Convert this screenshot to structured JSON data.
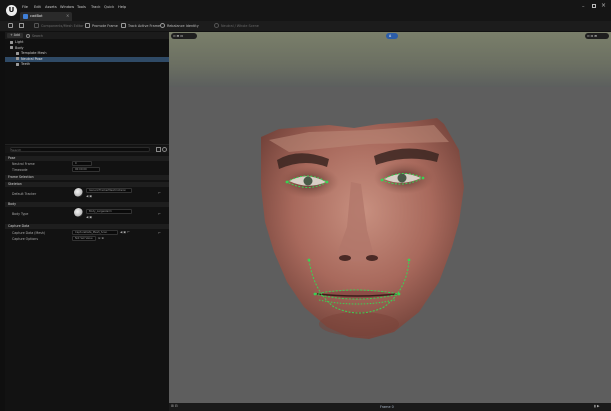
{
  "app": {
    "tab_title": "cadBot"
  },
  "menu": [
    "File",
    "Edit",
    "Assets",
    "Window",
    "Tools",
    "Track",
    "Quick",
    "Help"
  ],
  "toolbar": {
    "dropdown_label": "Components/Mesh Editor",
    "promote_frame": "Promote Frame",
    "track_active_frame": "Track Active Frame",
    "rebalance_identity": "Rebalance Identity",
    "neutral_label": "Neutral / Whole Scene"
  },
  "outliner": {
    "add_label": "+ Add",
    "search_placeholder": "Search",
    "items": [
      {
        "label": "Light",
        "indent": 0,
        "selected": false
      },
      {
        "label": "Body",
        "indent": 0,
        "selected": false
      },
      {
        "label": "Template Mesh",
        "indent": 1,
        "selected": false
      },
      {
        "label": "Neutral Pose",
        "indent": 1,
        "selected": true
      },
      {
        "label": "Teeth",
        "indent": 1,
        "selected": false
      }
    ]
  },
  "details": {
    "search_placeholder": "Search",
    "sections": {
      "pose": "Pose",
      "frame_selection": "Frame Selection",
      "skeleton": "Skeleton",
      "body": "Body",
      "capture_data": "Capture Data"
    },
    "props": {
      "neutral_frame": "Neutral Frame",
      "frame_value": "0",
      "timecode": "Timecode",
      "timecode_value": "00:00:00",
      "tracker_asset": "Default Tracker",
      "tracker_value": "GenericTrackerMeshCollision",
      "body_type": "Body Type",
      "body_value": "Body_LargeAlarm",
      "capture_data_label": "Capture Data (Mesh)",
      "capture_data_value": "CaptureData_Mesh_Scan",
      "capture_options": "Capture Options",
      "capture_options_value": "Not Set Value"
    }
  },
  "viewport": {
    "frame_label": "Frame 0",
    "center_badge": "A"
  },
  "colors": {
    "accent": "#2f4a66",
    "tracker": "#39d353",
    "viewport_bg": "#5e5e5e"
  }
}
